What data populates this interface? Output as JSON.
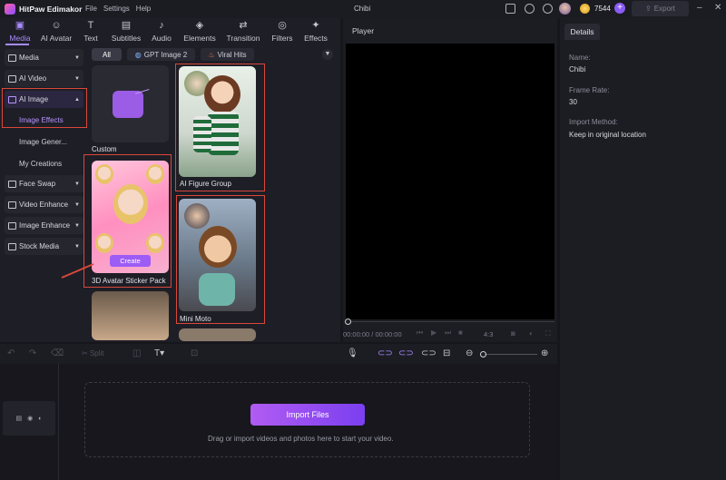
{
  "app": {
    "name": "HitPaw Edimakor",
    "menu": [
      "File",
      "Settings",
      "Help"
    ],
    "document_title": "Chibi",
    "credits": "7544",
    "export_label": "Export"
  },
  "top_tabs": [
    {
      "label": "Media",
      "icon": "media-icon"
    },
    {
      "label": "AI Avatar",
      "icon": "ai-avatar-icon"
    },
    {
      "label": "Text",
      "icon": "text-icon"
    },
    {
      "label": "Subtitles",
      "icon": "subtitles-icon"
    },
    {
      "label": "Audio",
      "icon": "audio-icon"
    },
    {
      "label": "Elements",
      "icon": "elements-icon"
    },
    {
      "label": "Transition",
      "icon": "transition-icon"
    },
    {
      "label": "Filters",
      "icon": "filters-icon"
    },
    {
      "label": "Effects",
      "icon": "effects-icon"
    }
  ],
  "sidebar": {
    "items": [
      "Media",
      "AI Video",
      "AI Image",
      "Face Swap",
      "Video Enhance",
      "Image Enhance",
      "Stock Media"
    ],
    "ai_image_sub": [
      "Image Effects",
      "Image Gener...",
      "My Creations"
    ]
  },
  "filter_chips": [
    "All",
    "GPT Image 2",
    "Viral Hits"
  ],
  "cards": {
    "custom": "Custom",
    "figure_group": "AI Figure Group",
    "sticker_pack": "3D Avatar Sticker Pack",
    "mini_moto": "Mini Moto",
    "create": "Create"
  },
  "player": {
    "label": "Player",
    "timecode": "00:00:00 / 00:00:00",
    "ratio": "4:3"
  },
  "details": {
    "tab": "Details",
    "fields": [
      {
        "key": "Name:",
        "value": "Chibi"
      },
      {
        "key": "Frame Rate:",
        "value": "30"
      },
      {
        "key": "Import Method:",
        "value": "Keep in original location"
      }
    ]
  },
  "toolbar": {
    "split": "Split"
  },
  "timeline": {
    "import_label": "Import Files",
    "hint": "Drag or import videos and photos here to start your video."
  },
  "colors": {
    "accent": "#a78bfa",
    "highlight_box": "#d9483b",
    "import_button": "#9d5cf5"
  }
}
